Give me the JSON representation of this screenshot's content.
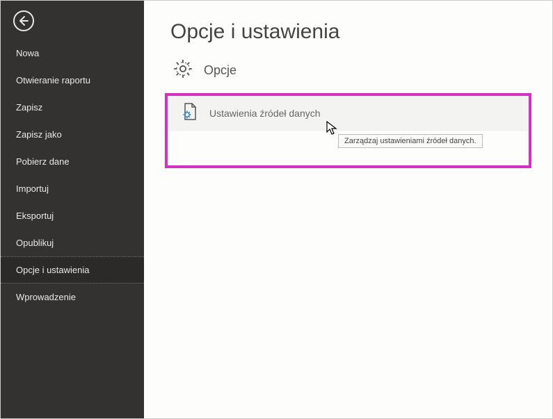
{
  "sidebar": {
    "items": [
      {
        "label": "Nowa"
      },
      {
        "label": "Otwieranie raportu"
      },
      {
        "label": "Zapisz"
      },
      {
        "label": "Zapisz jako"
      },
      {
        "label": "Pobierz dane"
      },
      {
        "label": "Importuj"
      },
      {
        "label": "Eksportuj"
      },
      {
        "label": "Opublikuj"
      },
      {
        "label": "Opcje i ustawienia"
      },
      {
        "label": "Wprowadzenie"
      }
    ]
  },
  "main": {
    "title": "Opcje i ustawienia",
    "section": {
      "title": "Opcje"
    },
    "option": {
      "label": "Ustawienia źródeł danych"
    },
    "tooltip": "Zarządzaj ustawieniami źródeł danych."
  }
}
